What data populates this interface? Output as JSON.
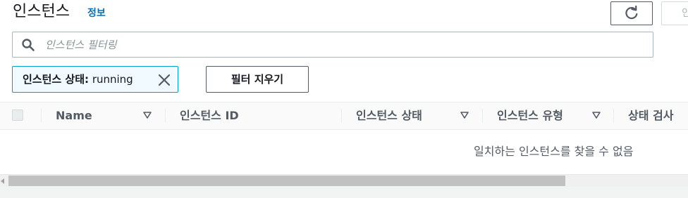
{
  "header": {
    "title": "인스턴스",
    "info_link": "정보",
    "next_button_partial": "인"
  },
  "search": {
    "placeholder": "인스턴스 필터링",
    "value": ""
  },
  "filter_token": {
    "key": "인스턴스 상태:",
    "value": "running"
  },
  "clear_filters_label": "필터 지우기",
  "table": {
    "columns": [
      {
        "label": "Name",
        "sortable": true
      },
      {
        "label": "인스턴스 ID",
        "sortable": false
      },
      {
        "label": "인스턴스 상태",
        "sortable": true
      },
      {
        "label": "인스턴스 유형",
        "sortable": true
      },
      {
        "label": "상태 검사",
        "sortable": false
      }
    ],
    "empty_message": "일치하는 인스턴스를 찾을 수 없음"
  },
  "icons": {
    "refresh": "refresh-icon",
    "search": "search-icon",
    "remove_token": "close-icon",
    "sort": "caret-down-icon",
    "scroll_left": "chevron-left-icon"
  },
  "colors": {
    "link": "#0073bb",
    "token_border": "#00a1c9",
    "token_background": "#f1faff",
    "text_primary": "#16191f",
    "text_secondary": "#545b64"
  }
}
